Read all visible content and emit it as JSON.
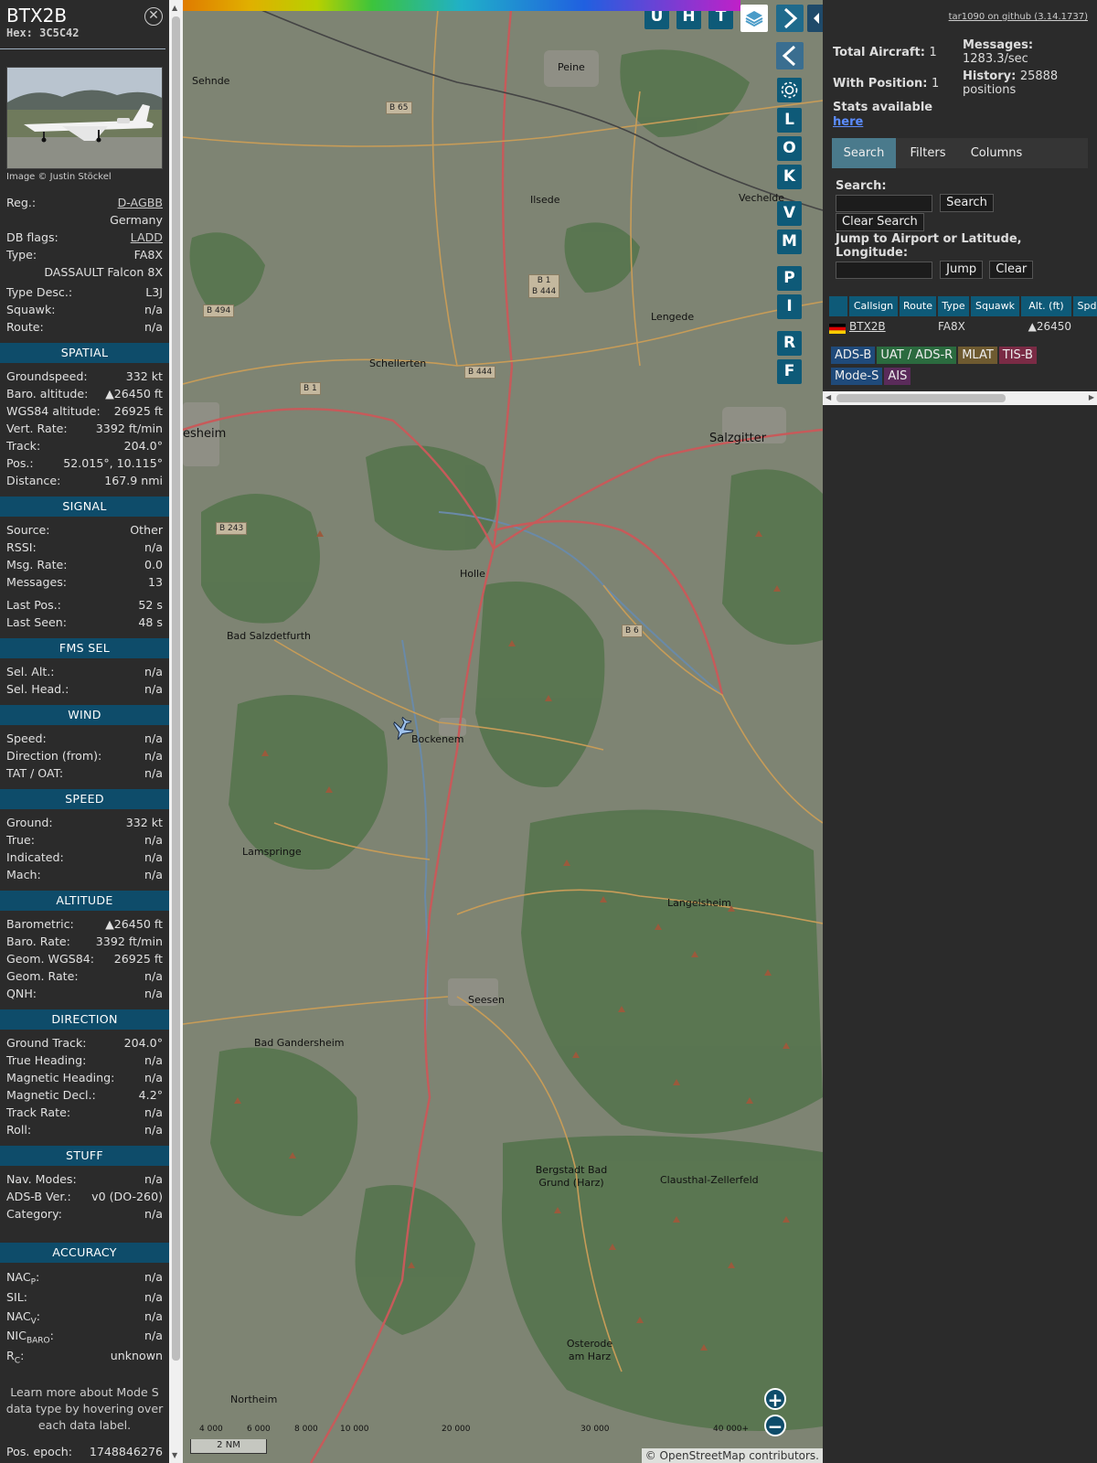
{
  "info": {
    "callsign": "BTX2B",
    "hex_label": "Hex:",
    "hex": "3C5C42",
    "photo_credit": "Image © Justin Stöckel",
    "reg_label": "Reg.:",
    "reg": "D-AGBB",
    "country": "Germany",
    "dbflags_label": "DB flags:",
    "dbflags": "LADD",
    "type_label": "Type:",
    "type": "FA8X",
    "type_name": "DASSAULT Falcon 8X",
    "typedesc_label": "Type Desc.:",
    "typedesc": "L3J",
    "squawk_label": "Squawk:",
    "squawk": "n/a",
    "route_label": "Route:",
    "route": "n/a",
    "spatial": {
      "title": "SPATIAL",
      "rows": [
        {
          "k": "Groundspeed:",
          "v": "332 kt"
        },
        {
          "k": "Baro. altitude:",
          "v": "▲26450 ft"
        },
        {
          "k": "WGS84 altitude:",
          "v": "26925 ft"
        },
        {
          "k": "Vert. Rate:",
          "v": "3392 ft/min"
        },
        {
          "k": "Track:",
          "v": "204.0°"
        },
        {
          "k": "Pos.:",
          "v": "52.015°, 10.115°"
        },
        {
          "k": "Distance:",
          "v": "167.9 nmi"
        }
      ]
    },
    "signal": {
      "title": "SIGNAL",
      "rows": [
        {
          "k": "Source:",
          "v": "Other"
        },
        {
          "k": "RSSI:",
          "v": "n/a"
        },
        {
          "k": "Msg. Rate:",
          "v": "0.0"
        },
        {
          "k": "Messages:",
          "v": "13"
        }
      ],
      "rows2": [
        {
          "k": "Last Pos.:",
          "v": "52 s"
        },
        {
          "k": "Last Seen:",
          "v": "48 s"
        }
      ]
    },
    "fms": {
      "title": "FMS SEL",
      "rows": [
        {
          "k": "Sel. Alt.:",
          "v": "n/a"
        },
        {
          "k": "Sel. Head.:",
          "v": "n/a"
        }
      ]
    },
    "wind": {
      "title": "WIND",
      "rows": [
        {
          "k": "Speed:",
          "v": "n/a"
        },
        {
          "k": "Direction (from):",
          "v": "n/a"
        },
        {
          "k": "TAT / OAT:",
          "v": "n/a"
        }
      ]
    },
    "speed": {
      "title": "SPEED",
      "rows": [
        {
          "k": "Ground:",
          "v": "332 kt"
        },
        {
          "k": "True:",
          "v": "n/a"
        },
        {
          "k": "Indicated:",
          "v": "n/a"
        },
        {
          "k": "Mach:",
          "v": "n/a"
        }
      ]
    },
    "altitude": {
      "title": "ALTITUDE",
      "rows": [
        {
          "k": "Barometric:",
          "v": "▲26450 ft"
        },
        {
          "k": "Baro. Rate:",
          "v": "3392 ft/min"
        },
        {
          "k": "Geom. WGS84:",
          "v": "26925 ft"
        },
        {
          "k": "Geom. Rate:",
          "v": "n/a"
        },
        {
          "k": "QNH:",
          "v": "n/a"
        }
      ]
    },
    "direction": {
      "title": "DIRECTION",
      "rows": [
        {
          "k": "Ground Track:",
          "v": "204.0°"
        },
        {
          "k": "True Heading:",
          "v": "n/a"
        },
        {
          "k": "Magnetic Heading:",
          "v": "n/a"
        },
        {
          "k": "Magnetic Decl.:",
          "v": "4.2°"
        },
        {
          "k": "Track Rate:",
          "v": "n/a"
        },
        {
          "k": "Roll:",
          "v": "n/a"
        }
      ]
    },
    "stuff": {
      "title": "STUFF",
      "rows": [
        {
          "k": "Nav. Modes:",
          "v": "n/a"
        },
        {
          "k": "ADS-B Ver.:",
          "v": "v0 (DO-260)"
        },
        {
          "k": "Category:",
          "v": "n/a"
        }
      ]
    },
    "accuracy": {
      "title": "ACCURACY",
      "nacp_k": "NAC",
      "nacp_sub": "P",
      "nacp_v": "n/a",
      "sil_k": "SIL:",
      "sil_v": "n/a",
      "nacv_k": "NAC",
      "nacv_sub": "V",
      "nacv_v": "n/a",
      "nic_k": "NIC",
      "nic_sub": "BARO",
      "nic_v": "n/a",
      "rc_k": "R",
      "rc_sub": "C",
      "rc_v": "unknown"
    },
    "note": "Learn more about Mode S data type by hovering over each data label.",
    "epoch_label": "Pos. epoch:",
    "epoch": "1748846276"
  },
  "map": {
    "buttons_top": [
      "U",
      "H",
      "T"
    ],
    "side_buttons": [
      "L",
      "O",
      "K",
      "V",
      "M",
      "P",
      "I",
      "R",
      "F"
    ],
    "places": [
      {
        "name": "Sehnde"
      },
      {
        "name": "Peine"
      },
      {
        "name": "Ilsede"
      },
      {
        "name": "Vechelde"
      },
      {
        "name": "Lengede"
      },
      {
        "name": "Schellerten"
      },
      {
        "name": "Salzgitter"
      },
      {
        "name": "esheim"
      },
      {
        "name": "Holle"
      },
      {
        "name": "Bad Salzdetfurth"
      },
      {
        "name": "Bockenem"
      },
      {
        "name": "Lamspringe"
      },
      {
        "name": "Langelsheim"
      },
      {
        "name": "Seesen"
      },
      {
        "name": "Bad Gandersheim"
      },
      {
        "name": "Bergstadt Bad Grund (Harz)"
      },
      {
        "name": "Clausthal-Zellerfeld"
      },
      {
        "name": "Osterode am Harz"
      },
      {
        "name": "Northeim"
      }
    ],
    "roads": [
      "B 65",
      "B 1\nB 444",
      "B 494",
      "B 444",
      "B 1",
      "B 243",
      "B 6"
    ],
    "alt_ticks": [
      "4 000",
      "6 000",
      "8 000",
      "10 000",
      "20 000",
      "30 000",
      "40 000+"
    ],
    "scale": "2 NM",
    "attribution": "© OpenStreetMap contributors."
  },
  "sidebar": {
    "github": "tar1090 on github (3.14.1737)",
    "total_label": "Total Aircraft:",
    "total": "1",
    "withpos_label": "With Position:",
    "withpos": "1",
    "stats_label": "Stats available",
    "stats_link": "here",
    "messages_label": "Messages:",
    "messages": "1283.3/sec",
    "history_label": "History:",
    "history": "25888 positions",
    "tabs": [
      "Search",
      "Filters",
      "Columns"
    ],
    "search_label": "Search:",
    "search_btn": "Search",
    "clear_search_btn": "Clear Search",
    "jump_label": "Jump to Airport or Latitude, Longitude:",
    "jump_btn": "Jump",
    "clear_btn": "Clear",
    "columns": [
      "Callsign",
      "Route",
      "Type",
      "Squawk",
      "Alt. (ft)",
      "Spd"
    ],
    "rows": [
      {
        "callsign": "BTX2B",
        "route": "",
        "type": "FA8X",
        "squawk": "",
        "alt": "▲26450",
        "spd": ""
      }
    ],
    "badges": [
      {
        "label": "ADS-B",
        "color": "#1f4a7a"
      },
      {
        "label": "UAT / ADS-R",
        "color": "#2b6b3f"
      },
      {
        "label": "MLAT",
        "color": "#6e5a30"
      },
      {
        "label": "TIS-B",
        "color": "#7a2b45"
      },
      {
        "label": "Mode-S",
        "color": "#1f4a7a"
      },
      {
        "label": "AIS",
        "color": "#5a2b5a"
      }
    ]
  }
}
